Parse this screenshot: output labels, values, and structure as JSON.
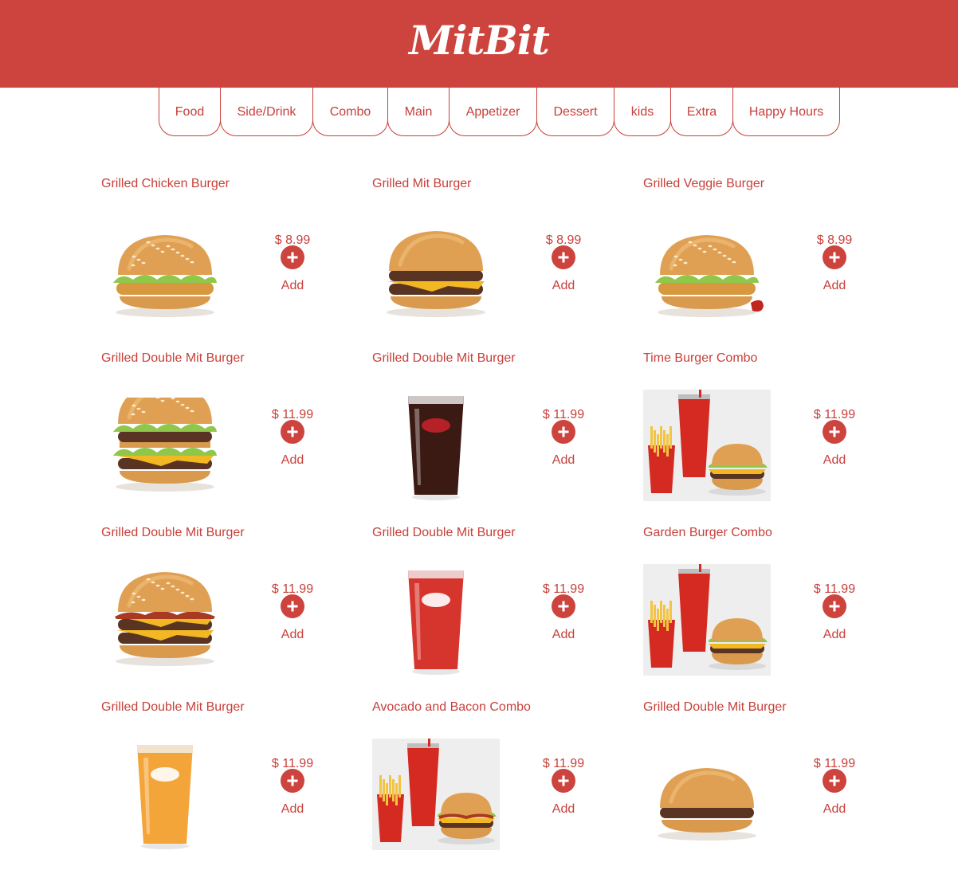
{
  "app": {
    "logo": "MitBit"
  },
  "tabs": [
    "Food",
    "Side/Drink",
    "Combo",
    "Main",
    "Appetizer",
    "Dessert",
    "kids",
    "Extra",
    "Happy Hours"
  ],
  "add_label": "Add",
  "items": [
    {
      "title": "Grilled Chicken Burger",
      "price": "$ 8.99",
      "image": "chicken-burger"
    },
    {
      "title": "Grilled Mit Burger",
      "price": "$ 8.99",
      "image": "cheese-burger"
    },
    {
      "title": "Grilled Veggie Burger",
      "price": "$ 8.99",
      "image": "veggie-burger"
    },
    {
      "title": "Grilled Double Mit Burger",
      "price": "$ 11.99",
      "image": "big-burger"
    },
    {
      "title": "Grilled Double Mit Burger",
      "price": "$ 11.99",
      "image": "cola-glass"
    },
    {
      "title": "Time Burger Combo",
      "price": "$ 11.99",
      "image": "combo-fries-drink"
    },
    {
      "title": "Grilled Double Mit Burger",
      "price": "$ 11.99",
      "image": "bacon-burger"
    },
    {
      "title": "Grilled Double Mit Burger",
      "price": "$ 11.99",
      "image": "red-drink-glass"
    },
    {
      "title": "Garden Burger Combo",
      "price": "$ 11.99",
      "image": "combo-cola"
    },
    {
      "title": "Grilled Double Mit Burger",
      "price": "$ 11.99",
      "image": "orange-drink-glass"
    },
    {
      "title": "Avocado and Bacon Combo",
      "price": "$ 11.99",
      "image": "combo-bacon"
    },
    {
      "title": "Grilled Double Mit Burger",
      "price": "$ 11.99",
      "image": "plain-burger"
    }
  ],
  "colors": {
    "brand": "#cc443d",
    "text": "#c8403a"
  }
}
